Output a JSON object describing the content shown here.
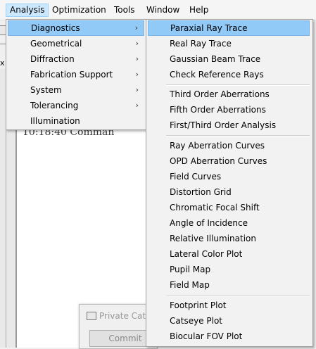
{
  "menubar": {
    "items": [
      "Analysis",
      "Optimization",
      "Tools",
      "Window",
      "Help"
    ]
  },
  "analysis_menu": {
    "items": [
      {
        "label": "Diagnostics",
        "submenu": true,
        "highlighted": true
      },
      {
        "label": "Geometrical",
        "submenu": true
      },
      {
        "label": "Diffraction",
        "submenu": true
      },
      {
        "label": "Fabrication Support",
        "submenu": true
      },
      {
        "label": "System",
        "submenu": true
      },
      {
        "label": "Tolerancing",
        "submenu": true
      },
      {
        "label": "Illumination",
        "submenu": false
      }
    ],
    "arrow_glyph": "›"
  },
  "diagnostics_menu": {
    "groups": [
      [
        "Paraxial Ray Trace",
        "Real Ray Trace",
        "Gaussian Beam Trace",
        "Check Reference Rays"
      ],
      [
        "Third Order Aberrations",
        "Fifth Order Aberrations",
        "First/Third Order Analysis"
      ],
      [
        "Ray Aberration Curves",
        "OPD Aberration Curves",
        "Field Curves",
        "Distortion Grid",
        "Chromatic Focal Shift",
        "Angle of Incidence",
        "Relative Illumination",
        "Lateral Color Plot",
        "Pupil Map",
        "Field Map"
      ],
      [
        "Footprint Plot",
        "Catseye Plot",
        "Biocular FOV Plot"
      ]
    ],
    "highlighted": "Paraxial Ray Trace"
  },
  "background": {
    "log_text": "10:18:40   Comman",
    "dialog_title": "Private Cata",
    "dialog_button": "Commit",
    "fragments": [
      "x"
    ]
  },
  "colors": {
    "menu_bg": "#f2f2f2",
    "highlight": "#91c9f7",
    "menubar_active": "#cce8ff"
  }
}
